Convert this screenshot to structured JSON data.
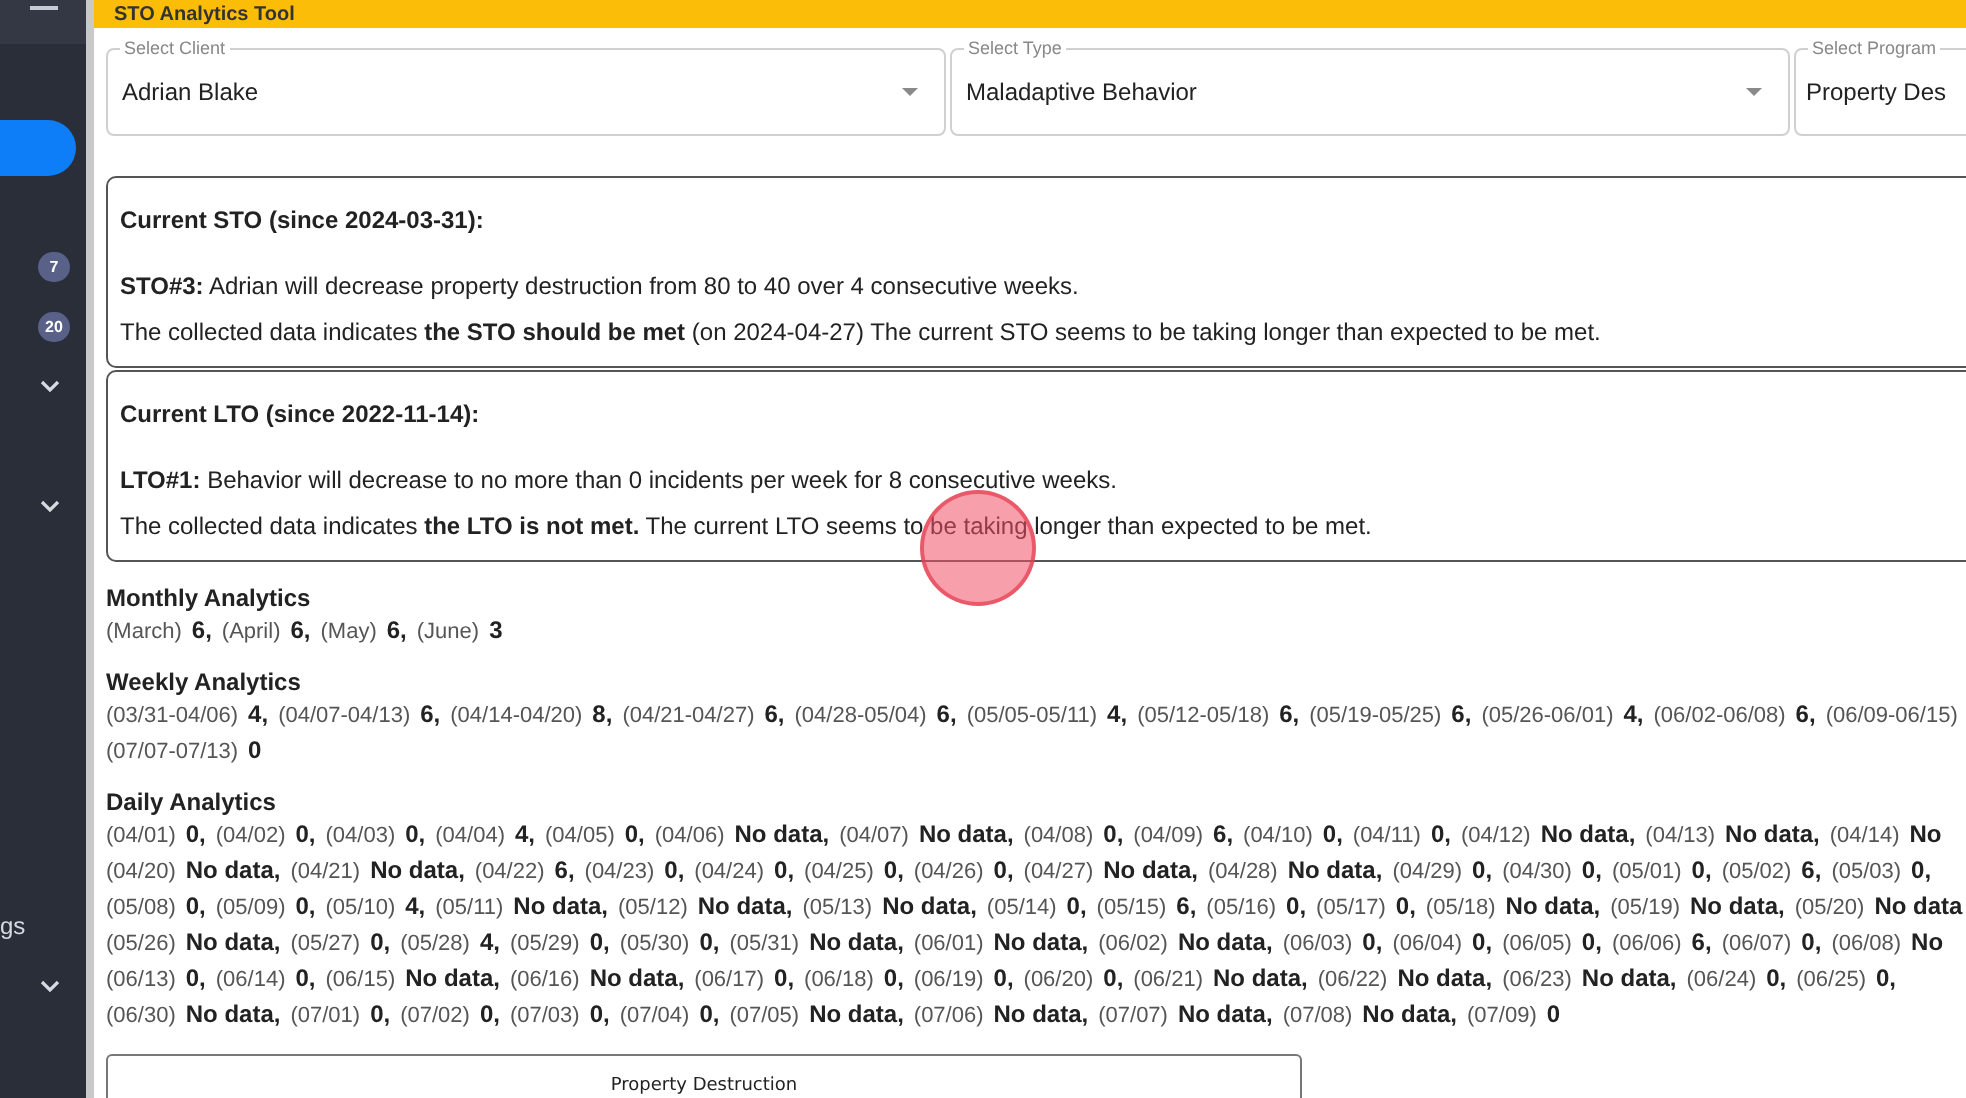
{
  "sidebar": {
    "items": [
      {
        "kind": "pill",
        "selected": true
      },
      {
        "kind": "badge",
        "badge": "7"
      },
      {
        "kind": "badge",
        "badge": "20"
      },
      {
        "kind": "chevron",
        "expanded": false
      },
      {
        "kind": "chevron",
        "expanded": false
      },
      {
        "kind": "label",
        "label": "gs"
      },
      {
        "kind": "chevron",
        "expanded": false
      }
    ]
  },
  "header": {
    "title": "STO Analytics Tool"
  },
  "selects": [
    {
      "label": "Select Client",
      "value": "Adrian Blake"
    },
    {
      "label": "Select Type",
      "value": "Maladaptive Behavior"
    },
    {
      "label": "Select Program",
      "value": "Property Des"
    }
  ],
  "objectives": [
    {
      "title": "Current STO (since 2024-03-31):",
      "goal": "**STO#3:**  Adrian will decrease property destruction from 80 to 40 over 4 consecutive weeks.",
      "status": "The collected data indicates **the STO should be met** (on 2024-04-27) The current STO seems to be taking longer than expected to be met."
    },
    {
      "title": "Current LTO (since 2022-11-14):",
      "goal": "**LTO#1:**  Behavior will decrease to no more than 0 incidents per week for 8 consecutive weeks.",
      "status": "The collected data indicates **the LTO is not met.** The current LTO seems to be taking longer than expected to be met."
    }
  ],
  "analytics": [
    {
      "title": "Monthly Analytics",
      "lines": [
        [
          [
            "(March)",
            "6,"
          ],
          [
            "(April)",
            "6,"
          ],
          [
            "(May)",
            "6,"
          ],
          [
            "(June)",
            "3"
          ]
        ]
      ]
    },
    {
      "title": "Weekly Analytics",
      "lines": [
        [
          [
            "(03/31-04/06)",
            "4,"
          ],
          [
            "(04/07-04/13)",
            "6,"
          ],
          [
            "(04/14-04/20)",
            "8,"
          ],
          [
            "(04/21-04/27)",
            "6,"
          ],
          [
            "(04/28-05/04)",
            "6,"
          ],
          [
            "(05/05-05/11)",
            "4,"
          ],
          [
            "(05/12-05/18)",
            "6,"
          ],
          [
            "(05/19-05/25)",
            "6,"
          ],
          [
            "(05/26-06/01)",
            "4,"
          ],
          [
            "(06/02-06/08)",
            "6,"
          ],
          [
            "(06/09-06/15)"
          ]
        ],
        [
          [
            "(07/07-07/13)",
            "0"
          ]
        ]
      ]
    },
    {
      "title": "Daily Analytics",
      "lines": [
        [
          [
            "(04/01)",
            "0,"
          ],
          [
            "(04/02)",
            "0,"
          ],
          [
            "(04/03)",
            "0,"
          ],
          [
            "(04/04)",
            "4,"
          ],
          [
            "(04/05)",
            "0,"
          ],
          [
            "(04/06)",
            "No data,"
          ],
          [
            "(04/07)",
            "No data,"
          ],
          [
            "(04/08)",
            "0,"
          ],
          [
            "(04/09)",
            "6,"
          ],
          [
            "(04/10)",
            "0,"
          ],
          [
            "(04/11)",
            "0,"
          ],
          [
            "(04/12)",
            "No data,"
          ],
          [
            "(04/13)",
            "No data,"
          ],
          [
            "(04/14)",
            "No"
          ]
        ],
        [
          [
            "(04/20)",
            "No data,"
          ],
          [
            "(04/21)",
            "No data,"
          ],
          [
            "(04/22)",
            "6,"
          ],
          [
            "(04/23)",
            "0,"
          ],
          [
            "(04/24)",
            "0,"
          ],
          [
            "(04/25)",
            "0,"
          ],
          [
            "(04/26)",
            "0,"
          ],
          [
            "(04/27)",
            "No data,"
          ],
          [
            "(04/28)",
            "No data,"
          ],
          [
            "(04/29)",
            "0,"
          ],
          [
            "(04/30)",
            "0,"
          ],
          [
            "(05/01)",
            "0,"
          ],
          [
            "(05/02)",
            "6,"
          ],
          [
            "(05/03)",
            "0,"
          ]
        ],
        [
          [
            "(05/08)",
            "0,"
          ],
          [
            "(05/09)",
            "0,"
          ],
          [
            "(05/10)",
            "4,"
          ],
          [
            "(05/11)",
            "No data,"
          ],
          [
            "(05/12)",
            "No data,"
          ],
          [
            "(05/13)",
            "No data,"
          ],
          [
            "(05/14)",
            "0,"
          ],
          [
            "(05/15)",
            "6,"
          ],
          [
            "(05/16)",
            "0,"
          ],
          [
            "(05/17)",
            "0,"
          ],
          [
            "(05/18)",
            "No data,"
          ],
          [
            "(05/19)",
            "No data,"
          ],
          [
            "(05/20)",
            "No data"
          ]
        ],
        [
          [
            "(05/26)",
            "No data,"
          ],
          [
            "(05/27)",
            "0,"
          ],
          [
            "(05/28)",
            "4,"
          ],
          [
            "(05/29)",
            "0,"
          ],
          [
            "(05/30)",
            "0,"
          ],
          [
            "(05/31)",
            "No data,"
          ],
          [
            "(06/01)",
            "No data,"
          ],
          [
            "(06/02)",
            "No data,"
          ],
          [
            "(06/03)",
            "0,"
          ],
          [
            "(06/04)",
            "0,"
          ],
          [
            "(06/05)",
            "0,"
          ],
          [
            "(06/06)",
            "6,"
          ],
          [
            "(06/07)",
            "0,"
          ],
          [
            "(06/08)",
            "No"
          ]
        ],
        [
          [
            "(06/13)",
            "0,"
          ],
          [
            "(06/14)",
            "0,"
          ],
          [
            "(06/15)",
            "No data,"
          ],
          [
            "(06/16)",
            "No data,"
          ],
          [
            "(06/17)",
            "0,"
          ],
          [
            "(06/18)",
            "0,"
          ],
          [
            "(06/19)",
            "0,"
          ],
          [
            "(06/20)",
            "0,"
          ],
          [
            "(06/21)",
            "No data,"
          ],
          [
            "(06/22)",
            "No data,"
          ],
          [
            "(06/23)",
            "No data,"
          ],
          [
            "(06/24)",
            "0,"
          ],
          [
            "(06/25)",
            "0,"
          ]
        ],
        [
          [
            "(06/30)",
            "No data,"
          ],
          [
            "(07/01)",
            "0,"
          ],
          [
            "(07/02)",
            "0,"
          ],
          [
            "(07/03)",
            "0,"
          ],
          [
            "(07/04)",
            "0,"
          ],
          [
            "(07/05)",
            "No data,"
          ],
          [
            "(07/06)",
            "No data,"
          ],
          [
            "(07/07)",
            "No data,"
          ],
          [
            "(07/08)",
            "No data,"
          ],
          [
            "(07/09)",
            "0"
          ]
        ]
      ]
    }
  ],
  "chart": {
    "title": "Property Destruction"
  }
}
